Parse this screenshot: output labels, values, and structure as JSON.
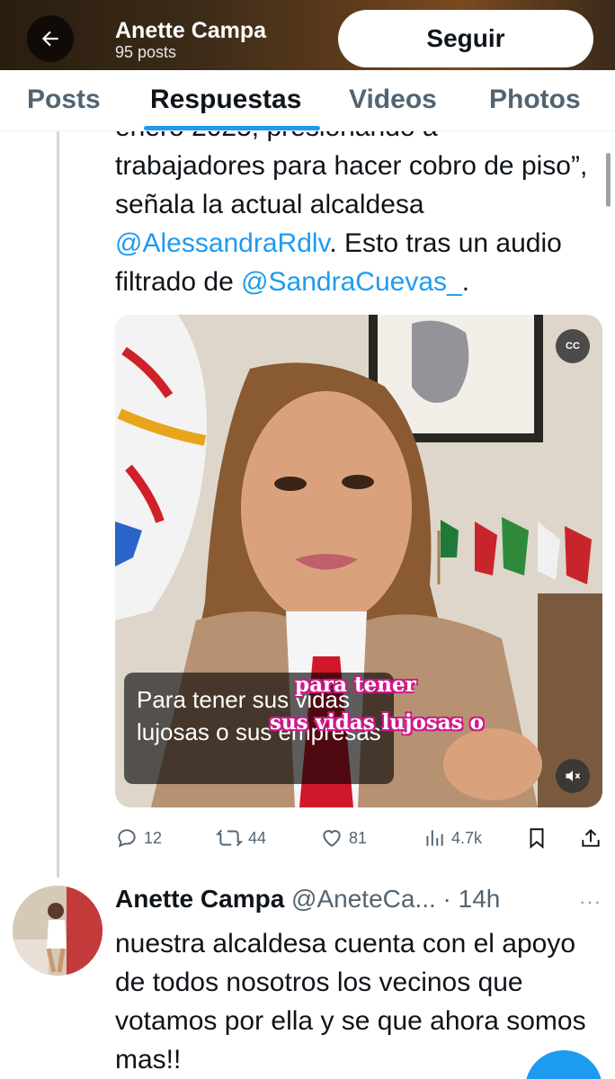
{
  "header": {
    "name": "Anette Campa",
    "post_count": "95 posts",
    "follow_label": "Seguir",
    "back_icon": "arrow-left-icon"
  },
  "tabs": [
    {
      "label": "Posts",
      "active": false
    },
    {
      "label": "Respuestas",
      "active": true
    },
    {
      "label": "Videos",
      "active": false
    },
    {
      "label": "Photos",
      "active": false
    }
  ],
  "tweet1": {
    "text_cut": "enero 2025, presionando a",
    "text_a": "trabajadores para hacer cobro de piso”, señala la actual alcaldesa ",
    "mention_1": "@AlessandraRdlv",
    "text_b": ". Esto tras un audio filtrado de ",
    "mention_2": "@SandraCuevas_",
    "text_c": ".",
    "video": {
      "caption": "Para tener sus vidas lujosas o sus empresas",
      "burned_line_1": "para tener",
      "burned_line_2": "sus vidas lujosas o",
      "cc_label": "CC",
      "mute_icon": "speaker-mute-icon"
    },
    "actions": {
      "replies": "12",
      "reposts": "44",
      "likes": "81",
      "views": "4.7k"
    }
  },
  "tweet2": {
    "name": "Anette Campa",
    "meta": "@AneteCa... · 14h",
    "more": "···",
    "text": "nuestra alcaldesa cuenta con el apoyo de todos nosotros los vecinos que votamos por ella y se que ahora somos mas!!"
  },
  "colors": {
    "accent": "#1d9bf0",
    "text": "#0f1419",
    "muted": "#536471"
  }
}
